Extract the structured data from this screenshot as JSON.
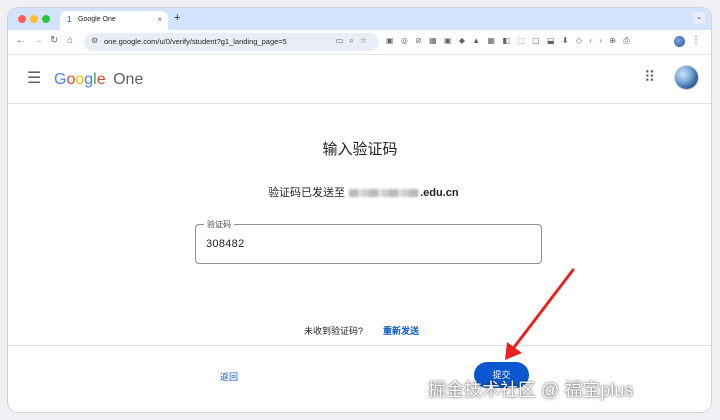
{
  "browser": {
    "tab_title": "Google One",
    "tab_favicon": "google-one-icon",
    "tab_close": "×",
    "new_tab": "+",
    "url": "one.google.com/u/0/verify/student?g1_landing_page=5"
  },
  "header": {
    "logo_letters": [
      {
        "t": "G",
        "c": "#4285F4"
      },
      {
        "t": "o",
        "c": "#EA4335"
      },
      {
        "t": "o",
        "c": "#FBBC05"
      },
      {
        "t": "g",
        "c": "#4285F4"
      },
      {
        "t": "l",
        "c": "#34A853"
      },
      {
        "t": "e",
        "c": "#EA4335"
      }
    ],
    "logo_product": "One",
    "logo_product_color": "#5f6368"
  },
  "main": {
    "heading": "输入验证码",
    "sent_prefix": "验证码已发送至",
    "sent_suffix": ".edu.cn",
    "field_label": "验证码",
    "field_value": "308482",
    "resend_prompt": "未收到验证码?",
    "resend_link": "重新发送",
    "back_label": "返回",
    "submit_label": "提交"
  },
  "watermark": "掘金技术社区 @ 福宝plus",
  "colors": {
    "accent": "#0b57d0",
    "annotation_arrow": "#e8231f",
    "tab_strip": "#d3e3fd"
  }
}
